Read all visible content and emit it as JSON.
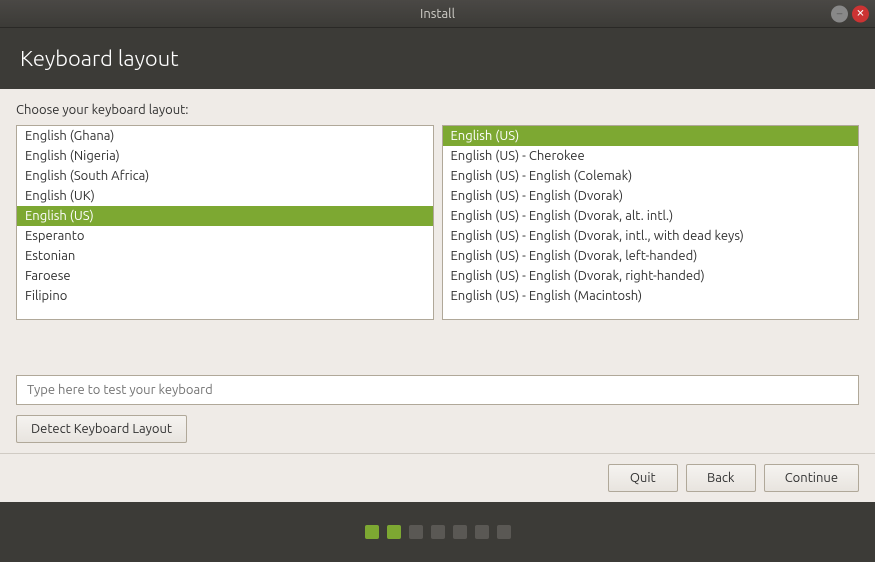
{
  "titlebar": {
    "title": "Install",
    "minimize_label": "–",
    "close_label": "✕"
  },
  "header": {
    "title": "Keyboard layout"
  },
  "body": {
    "choose_label": "Choose your keyboard layout:",
    "left_list": {
      "items": [
        {
          "label": "English (Ghana)",
          "selected": false
        },
        {
          "label": "English (Nigeria)",
          "selected": false
        },
        {
          "label": "English (South Africa)",
          "selected": false
        },
        {
          "label": "English (UK)",
          "selected": false
        },
        {
          "label": "English (US)",
          "selected": true
        },
        {
          "label": "Esperanto",
          "selected": false
        },
        {
          "label": "Estonian",
          "selected": false
        },
        {
          "label": "Faroese",
          "selected": false
        },
        {
          "label": "Filipino",
          "selected": false
        }
      ]
    },
    "right_list": {
      "items": [
        {
          "label": "English (US)",
          "selected": true
        },
        {
          "label": "English (US) - Cherokee",
          "selected": false
        },
        {
          "label": "English (US) - English (Colemak)",
          "selected": false
        },
        {
          "label": "English (US) - English (Dvorak)",
          "selected": false
        },
        {
          "label": "English (US) - English (Dvorak, alt. intl.)",
          "selected": false
        },
        {
          "label": "English (US) - English (Dvorak, intl., with dead keys)",
          "selected": false
        },
        {
          "label": "English (US) - English (Dvorak, left-handed)",
          "selected": false
        },
        {
          "label": "English (US) - English (Dvorak, right-handed)",
          "selected": false
        },
        {
          "label": "English (US) - English (Macintosh)",
          "selected": false
        }
      ]
    },
    "test_input_placeholder": "Type here to test your keyboard",
    "detect_button_label": "Detect Keyboard Layout"
  },
  "footer": {
    "quit_label": "Quit",
    "back_label": "Back",
    "continue_label": "Continue"
  },
  "dots": {
    "total": 7,
    "active_indices": [
      0,
      1
    ]
  }
}
